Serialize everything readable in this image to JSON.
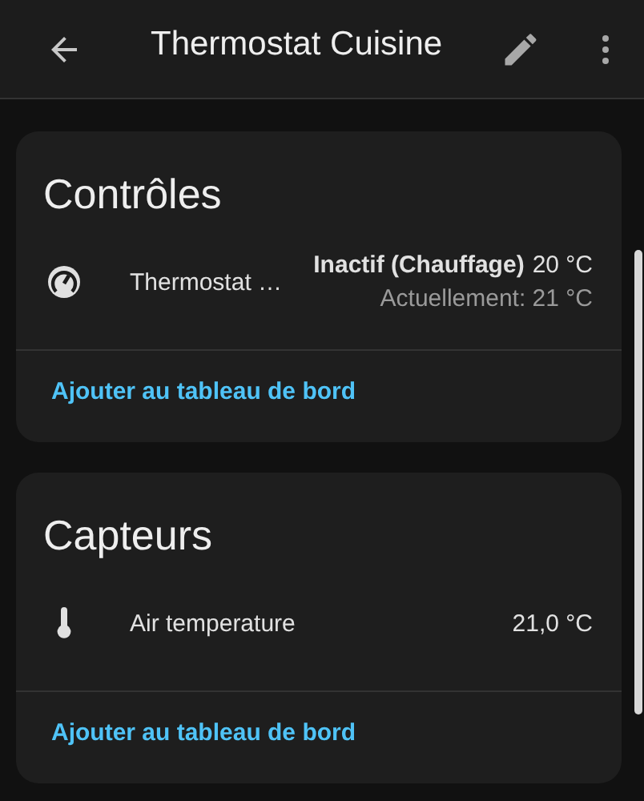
{
  "header": {
    "title": "Thermostat Cuisine"
  },
  "cards": [
    {
      "title": "Contrôles",
      "entities": [
        {
          "kind": "climate",
          "name": "Thermostat …",
          "state": "Inactif (Chauffage)",
          "target": "20 °C",
          "current": "Actuellement: 21 °C"
        }
      ],
      "action": "Ajouter au tableau de bord"
    },
    {
      "title": "Capteurs",
      "entities": [
        {
          "kind": "sensor",
          "name": "Air temperature",
          "value": "21,0 °C"
        }
      ],
      "action": "Ajouter au tableau de bord"
    }
  ]
}
